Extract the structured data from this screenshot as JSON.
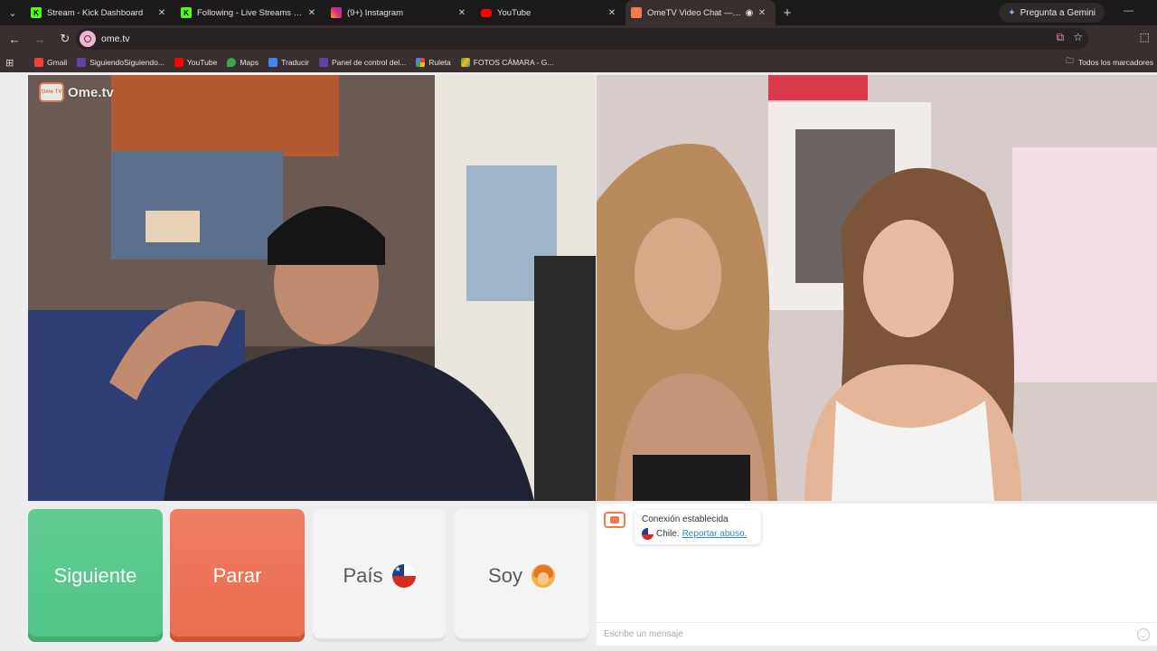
{
  "browser": {
    "tabs": [
      {
        "title": "Stream - Kick Dashboard",
        "favicon": "kick-icon",
        "color": "#53fc18",
        "letter": "K"
      },
      {
        "title": "Following - Live Streams on Kick",
        "favicon": "kick-icon",
        "color": "#53fc18",
        "letter": "K"
      },
      {
        "title": "(9+) Instagram",
        "favicon": "instagram-icon",
        "color": "#e1306c",
        "letter": ""
      },
      {
        "title": "YouTube",
        "favicon": "youtube-icon",
        "color": "#ff0000",
        "letter": ""
      },
      {
        "title": "OmeTV Video Chat — Omegle",
        "favicon": "ometv-icon",
        "color": "#f17a53",
        "letter": ""
      }
    ],
    "new_tab": "+",
    "gemini_label": "Pregunta a Gemini",
    "url": "ome.tv",
    "bookmarks": [
      {
        "label": "Gmail",
        "color": "#ea4335"
      },
      {
        "label": "SiguiendoSiguiendo...",
        "color": "#6441a5"
      },
      {
        "label": "YouTube",
        "color": "#ff0000"
      },
      {
        "label": "Maps",
        "color": "#34a853"
      },
      {
        "label": "Traducir",
        "color": "#4285f4"
      },
      {
        "label": "Panel de control del...",
        "color": "#6441a5"
      },
      {
        "label": "Ruleta",
        "color": "#fbbc05"
      },
      {
        "label": "FOTOS CÁMARA - G...",
        "color": "#34a853"
      }
    ],
    "all_bookmarks": "Todos los marcadores"
  },
  "page": {
    "brand": "Ome.tv",
    "brand_badge": "Ome TV",
    "buttons": {
      "next": "Siguiente",
      "stop": "Parar",
      "country": "País",
      "gender": "Soy"
    },
    "chat": {
      "status": "Conexión establecida",
      "country": "Chile.",
      "report": "Reportar abuso.",
      "placeholder": "Escribe un mensaje"
    }
  }
}
